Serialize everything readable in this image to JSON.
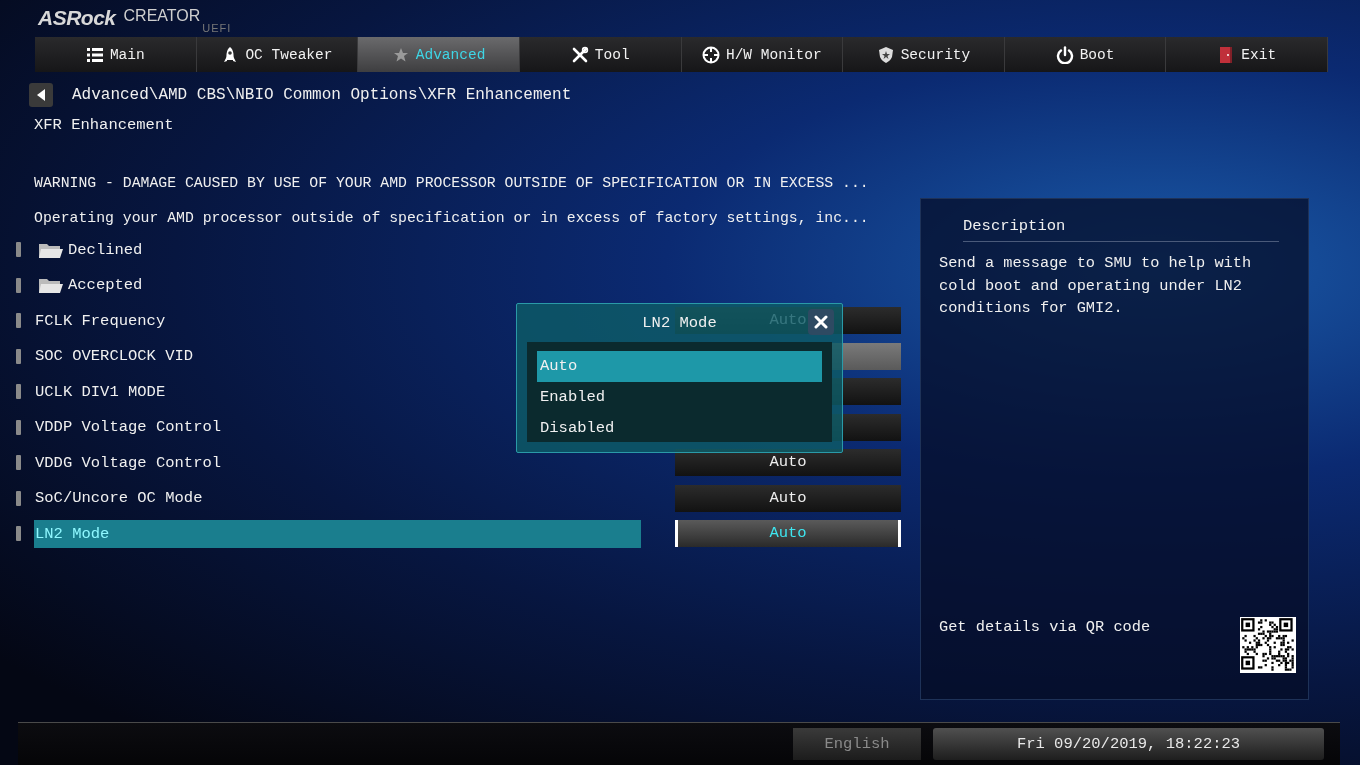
{
  "logo": {
    "brand": "ASRock",
    "edition": "CREATOR",
    "tag": "UEFI"
  },
  "tabs": [
    {
      "label": "Main",
      "selected": false
    },
    {
      "label": "OC Tweaker",
      "selected": false
    },
    {
      "label": "Advanced",
      "selected": true
    },
    {
      "label": "Tool",
      "selected": false
    },
    {
      "label": "H/W Monitor",
      "selected": false
    },
    {
      "label": "Security",
      "selected": false
    },
    {
      "label": "Boot",
      "selected": false
    },
    {
      "label": "Exit",
      "selected": false
    }
  ],
  "breadcrumb": "Advanced\\AMD CBS\\NBIO Common Options\\XFR Enhancement",
  "page_title": "XFR Enhancement",
  "warnings": [
    "WARNING - DAMAGE CAUSED BY USE OF YOUR AMD PROCESSOR OUTSIDE OF SPECIFICATION OR IN EXCESS ...",
    "Operating your AMD processor outside of specification or in excess of factory settings, inc..."
  ],
  "items": [
    {
      "kind": "folder",
      "label": "Declined",
      "selected": false
    },
    {
      "kind": "folder",
      "label": "Accepted",
      "selected": false
    },
    {
      "kind": "option",
      "label": "FCLK Frequency",
      "value": "Auto",
      "selected": false
    },
    {
      "kind": "number",
      "label": "SOC OVERCLOCK VID",
      "selected": false
    },
    {
      "kind": "option",
      "label": "UCLK DIV1 MODE",
      "selected": false
    },
    {
      "kind": "option",
      "label": "VDDP Voltage Control",
      "selected": false
    },
    {
      "kind": "option",
      "label": "VDDG Voltage Control",
      "value": "Auto",
      "selected": false
    },
    {
      "kind": "option",
      "label": "SoC/Uncore OC Mode",
      "value": "Auto",
      "selected": false
    },
    {
      "kind": "option",
      "label": "LN2 Mode",
      "value": "Auto",
      "selected": true
    }
  ],
  "popup": {
    "title": "LN2 Mode",
    "options": [
      {
        "label": "Auto",
        "selected": true
      },
      {
        "label": "Enabled",
        "selected": false
      },
      {
        "label": "Disabled",
        "selected": false
      }
    ]
  },
  "description": {
    "heading": "Description",
    "text": "Send a message to SMU to help with cold boot and operating under LN2 conditions for GMI2.",
    "qr_caption": "Get details via QR code"
  },
  "status_bar": {
    "language": "English",
    "datetime": "Fri 09/20/2019, 18:22:23"
  }
}
